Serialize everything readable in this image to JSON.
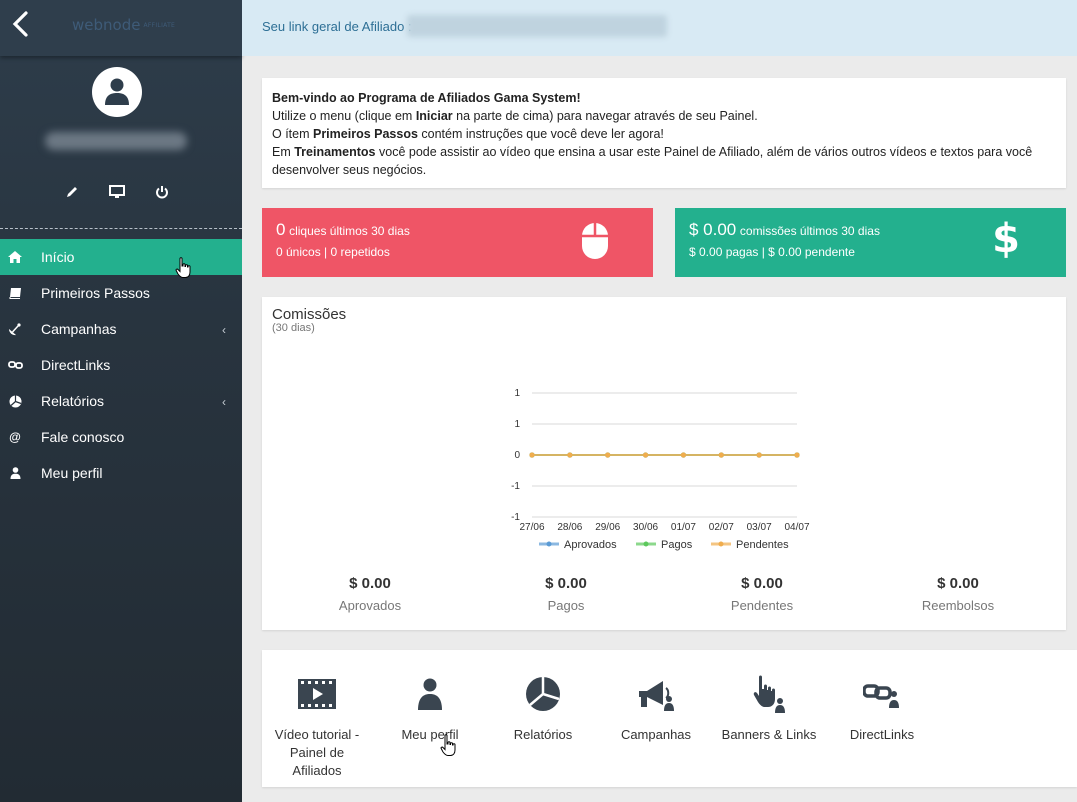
{
  "sidebar": {
    "logo": "webnode",
    "logo_tag": "AFFILIATE",
    "nav": [
      {
        "label": "Início",
        "icon": "home-icon",
        "active": true
      },
      {
        "label": "Primeiros Passos",
        "icon": "book-icon"
      },
      {
        "label": "Campanhas",
        "icon": "satellite-icon",
        "chevron": true
      },
      {
        "label": "DirectLinks",
        "icon": "link-icon"
      },
      {
        "label": "Relatórios",
        "icon": "pie-chart-icon",
        "chevron": true
      },
      {
        "label": "Fale conosco",
        "icon": "at-icon"
      },
      {
        "label": "Meu perfil",
        "icon": "user-icon"
      }
    ],
    "chevron": "‹"
  },
  "topbar": {
    "label": "Seu link geral de Afiliado :"
  },
  "welcome": {
    "title": "Bem-vindo ao Programa de Afiliados Gama System!",
    "l2a": "Utilize o menu (clique em ",
    "l2b": "Iniciar",
    "l2c": " na parte de cima) para navegar através de seu Painel.",
    "l3a": "O ítem ",
    "l3b": "Primeiros Passos",
    "l3c": " contém instruções que você deve ler agora!",
    "l4a": "Em ",
    "l4b": "Treinamentos",
    "l4c": " você pode assistir ao vídeo que ensina a usar este Painel de Afiliado, além de vários outros vídeos e textos para você desenvolver seus negócios."
  },
  "stats": {
    "clicks_value": "0",
    "clicks_label": "cliques últimos 30 dias",
    "clicks_detail": "0 únicos | 0 repetidos",
    "comm_value": "$ 0.00",
    "comm_label": "comissões últimos 30 dias",
    "comm_detail": "$ 0.00 pagas | $ 0.00 pendente"
  },
  "comissoes": {
    "title": "Comissões",
    "subtitle": "(30 dias)",
    "totals": [
      {
        "value": "$ 0.00",
        "label": "Aprovados"
      },
      {
        "value": "$ 0.00",
        "label": "Pagos"
      },
      {
        "value": "$ 0.00",
        "label": "Pendentes"
      },
      {
        "value": "$ 0.00",
        "label": "Reembolsos"
      }
    ]
  },
  "chart_data": {
    "type": "line",
    "x": [
      "27/06",
      "28/06",
      "29/06",
      "30/06",
      "01/07",
      "02/07",
      "03/07",
      "04/07"
    ],
    "y_ticks": [
      "1",
      "1",
      "0",
      "-1",
      "-1"
    ],
    "ylim": [
      -1,
      1
    ],
    "grid": true,
    "legend": "bottom",
    "series": [
      {
        "name": "Aprovados",
        "color": "#5b9bd5",
        "values": [
          0,
          0,
          0,
          0,
          0,
          0,
          0,
          0
        ]
      },
      {
        "name": "Pagos",
        "color": "#5cc85c",
        "values": [
          0,
          0,
          0,
          0,
          0,
          0,
          0,
          0
        ]
      },
      {
        "name": "Pendentes",
        "color": "#f0ad4e",
        "values": [
          0,
          0,
          0,
          0,
          0,
          0,
          0,
          0
        ]
      }
    ]
  },
  "shortcuts": [
    {
      "label": "Vídeo tutorial - Painel de Afiliados",
      "icon": "video-icon"
    },
    {
      "label": "Meu perfil",
      "icon": "user-icon"
    },
    {
      "label": "Relatórios",
      "icon": "pie-chart-icon"
    },
    {
      "label": "Campanhas",
      "icon": "megaphone-icon"
    },
    {
      "label": "Banners & Links",
      "icon": "hand-pointer-icon"
    },
    {
      "label": "DirectLinks",
      "icon": "link-icon"
    }
  ]
}
